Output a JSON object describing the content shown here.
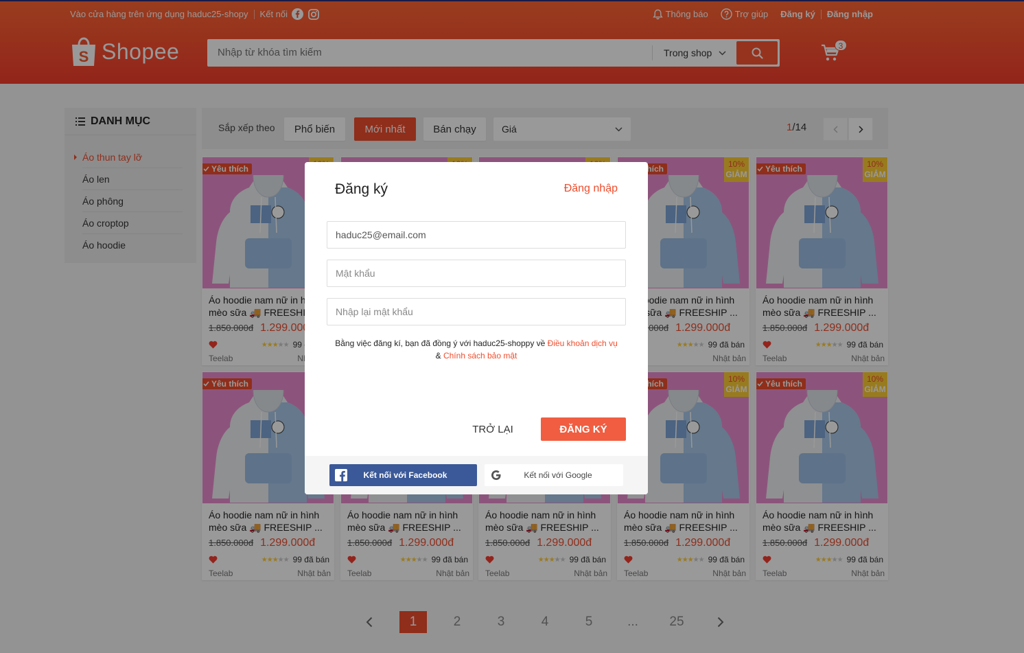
{
  "header": {
    "store_link": "Vào cửa hàng trên ứng dụng haduc25-shopy",
    "connect_label": "Kết nối",
    "notifications": "Thông báo",
    "help": "Trợ giúp",
    "signup": "Đăng ký",
    "login": "Đăng nhập",
    "logo_text": "Shopee",
    "search_placeholder": "Nhập từ khóa tìm kiếm",
    "search_scope": "Trong shop",
    "cart_count": "3",
    "brand_color": "#ee4d2d"
  },
  "sidebar": {
    "title": "DANH MỤC",
    "items": [
      {
        "label": "Áo thun tay lỡ"
      },
      {
        "label": "Áo len"
      },
      {
        "label": "Áo phông"
      },
      {
        "label": "Áo croptop"
      },
      {
        "label": "Áo hoodie"
      }
    ]
  },
  "sortbar": {
    "label": "Sắp xếp theo",
    "options": [
      "Phổ biến",
      "Mới nhất",
      "Bán chạy"
    ],
    "active": "Mới nhất",
    "price_select": "Giá",
    "page_current": "1",
    "page_total": "/14"
  },
  "product": {
    "favorite_tag": "Yêu thích",
    "discount_percent": "10%",
    "discount_word": "GIẢM",
    "name": "Áo hoodie nam nữ in hình mèo sữa 🚚 FREESHIP ...",
    "old_price": "1.850.000đ",
    "new_price": "1.299.000đ",
    "sold": "99 đã bán",
    "rating": 3,
    "brand": "Teelab",
    "origin": "Nhật bản",
    "image_colors": {
      "background": "#e98ccf",
      "hoodie_white": "#eef0f2",
      "hoodie_blue": "#a9c9ea"
    }
  },
  "pagination": {
    "pages": [
      "1",
      "2",
      "3",
      "4",
      "5",
      "...",
      "25"
    ],
    "active": "1"
  },
  "modal": {
    "title": "Đăng ký",
    "switch_login": "Đăng nhập",
    "email_value": "haduc25@email.com",
    "password_placeholder": "Mật khẩu",
    "confirm_placeholder": "Nhập lại mật khẩu",
    "terms_prefix": "Bằng việc đăng kí, bạn đã đồng ý với haduc25-shoppy về",
    "terms_link": "Điều khoản dịch vụ",
    "terms_and": "&",
    "privacy_link": "Chính sách bảo mật",
    "back_button": "TRỞ LẠI",
    "submit_button": "ĐĂNG KÝ",
    "facebook_button": "Kết nối với Facebook",
    "google_button": "Kết nối với Google"
  }
}
